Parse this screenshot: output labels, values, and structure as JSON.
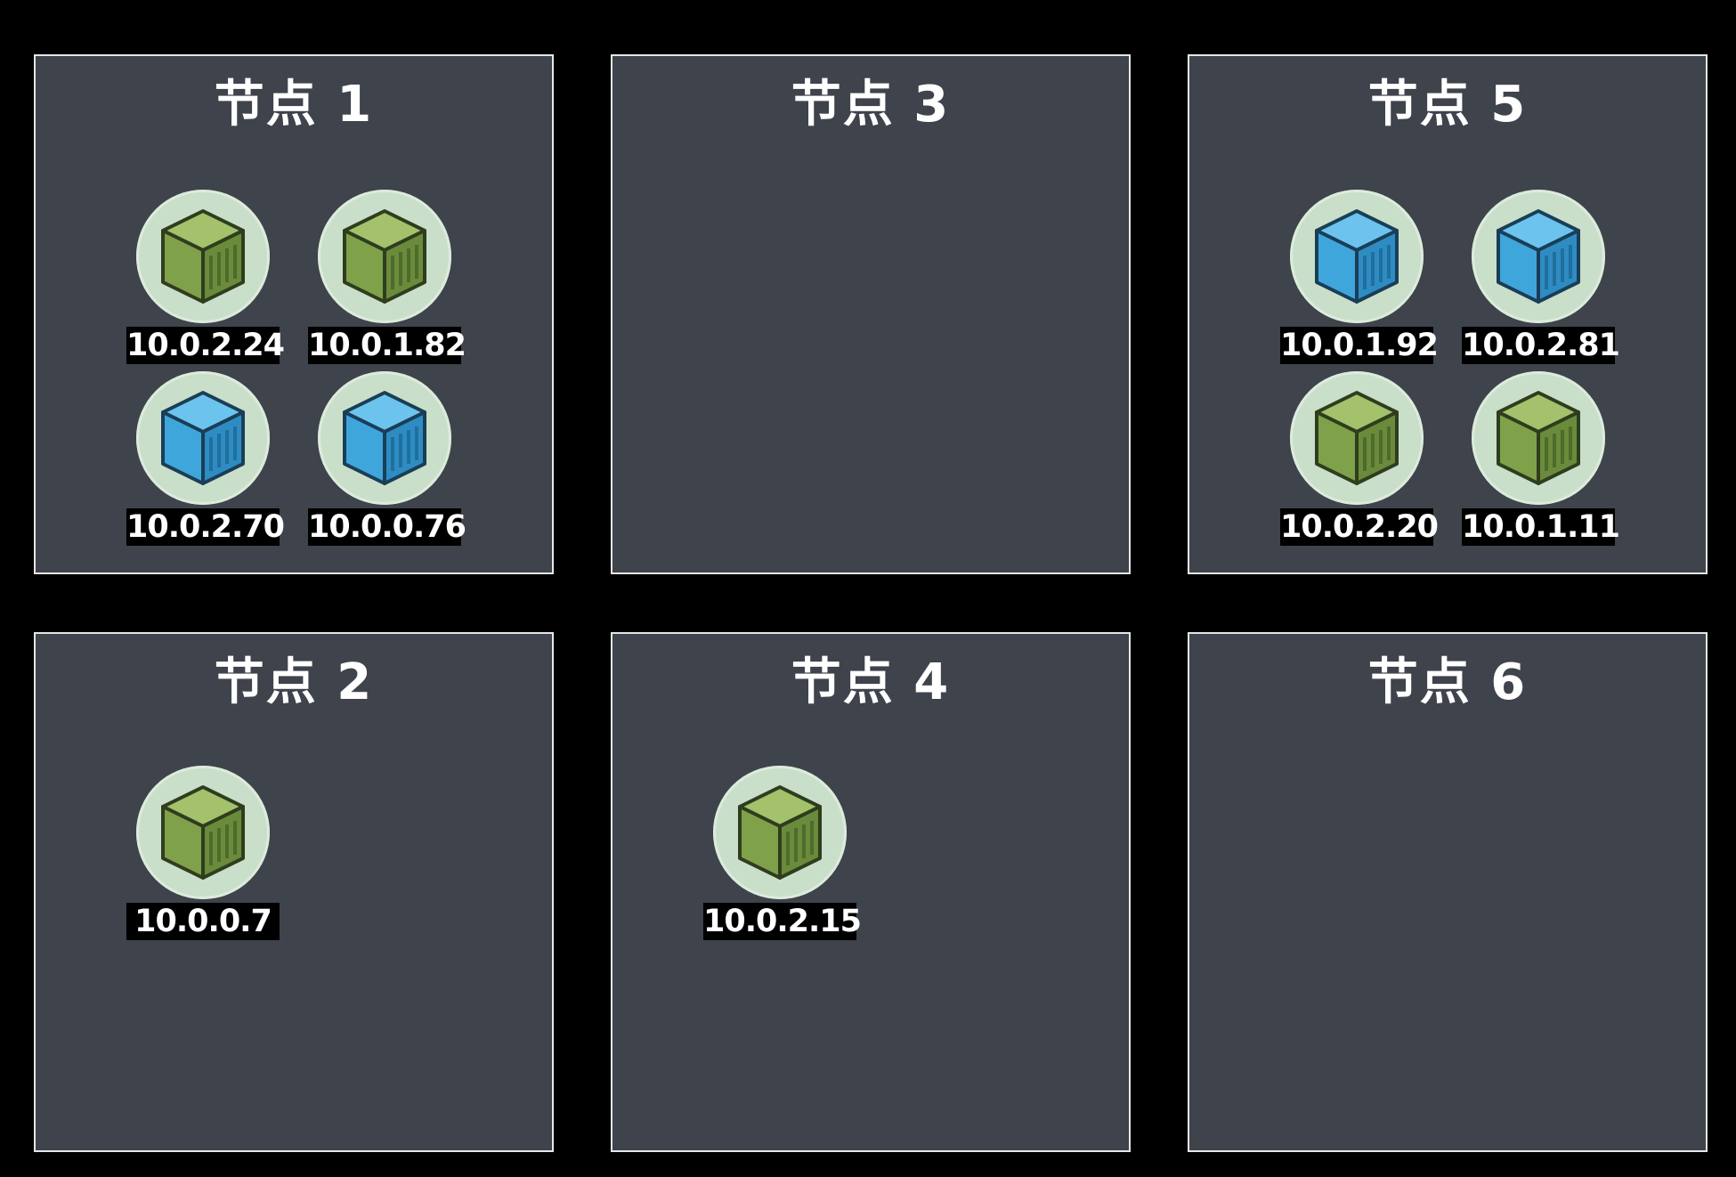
{
  "colors": {
    "background": "#000000",
    "node_fill": "#3f434b",
    "node_border": "#e6e6e6",
    "pod_circle": "#c9dfc9",
    "green_cube": "#86a84e",
    "blue_cube": "#3fa6dc"
  },
  "nodes": [
    {
      "title": "节点 1",
      "pods": [
        {
          "ip": "10.0.2.24",
          "color": "green",
          "icon": "container-cube-icon"
        },
        {
          "ip": "10.0.1.82",
          "color": "green",
          "icon": "container-cube-icon"
        },
        {
          "ip": "10.0.2.70",
          "color": "blue",
          "icon": "container-cube-icon"
        },
        {
          "ip": "10.0.0.76",
          "color": "blue",
          "icon": "container-cube-icon"
        }
      ]
    },
    {
      "title": "节点 3",
      "pods": []
    },
    {
      "title": "节点 5",
      "pods": [
        {
          "ip": "10.0.1.92",
          "color": "blue",
          "icon": "container-cube-icon"
        },
        {
          "ip": "10.0.2.81",
          "color": "blue",
          "icon": "container-cube-icon"
        },
        {
          "ip": "10.0.2.20",
          "color": "green",
          "icon": "container-cube-icon"
        },
        {
          "ip": "10.0.1.11",
          "color": "green",
          "icon": "container-cube-icon"
        }
      ]
    },
    {
      "title": "节点 2",
      "pods": [
        {
          "ip": "10.0.0.7",
          "color": "green",
          "icon": "container-cube-icon"
        }
      ]
    },
    {
      "title": "节点 4",
      "pods": [
        {
          "ip": "10.0.2.15",
          "color": "green",
          "icon": "container-cube-icon"
        }
      ]
    },
    {
      "title": "节点 6",
      "pods": []
    }
  ]
}
